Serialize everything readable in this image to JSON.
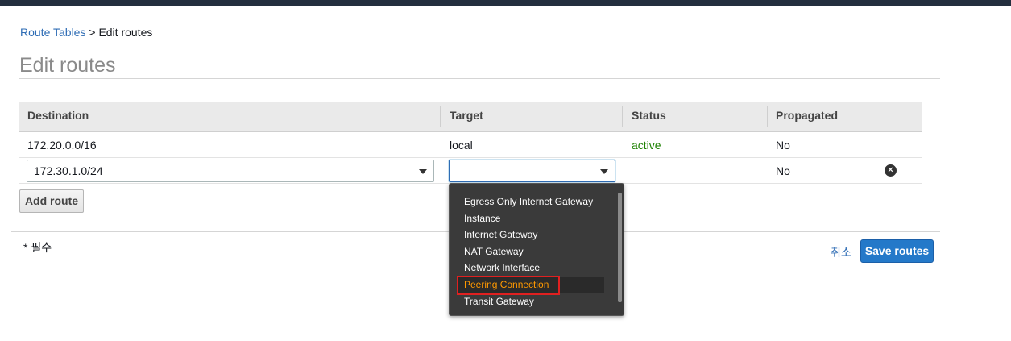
{
  "breadcrumb": {
    "parent": "Route Tables",
    "separator": " > ",
    "current": "Edit routes"
  },
  "page": {
    "title": "Edit routes"
  },
  "table": {
    "headers": {
      "destination": "Destination",
      "target": "Target",
      "status": "Status",
      "propagated": "Propagated"
    },
    "rows": [
      {
        "destination": "172.20.0.0/16",
        "target": "local",
        "status": "active",
        "propagated": "No"
      },
      {
        "destination": "172.30.1.0/24",
        "target": "",
        "status": "",
        "propagated": "No"
      }
    ]
  },
  "buttons": {
    "add_route": "Add route",
    "cancel": "취소",
    "save": "Save routes"
  },
  "footer": {
    "required_note": "* 필수"
  },
  "dropdown": {
    "options": [
      "Egress Only Internet Gateway",
      "Instance",
      "Internet Gateway",
      "NAT Gateway",
      "Network Interface",
      "Peering Connection",
      "Transit Gateway"
    ],
    "highlighted": "Peering Connection"
  },
  "icons": {
    "remove": "close-circle-icon",
    "dropdown_caret": "chevron-down-icon"
  },
  "colors": {
    "link": "#2f6db5",
    "active_status": "#1d8102",
    "primary_button": "#2479c9",
    "highlight_option": "#ff9900",
    "annotation_box": "#e02020"
  }
}
